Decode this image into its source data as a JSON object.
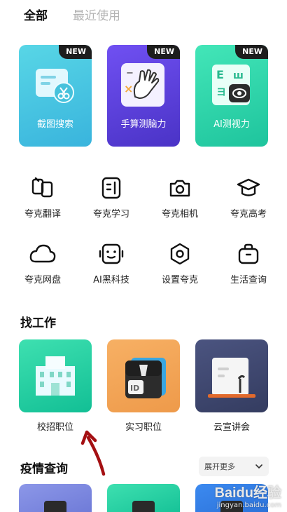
{
  "tabs": [
    {
      "label": "全部",
      "active": true
    },
    {
      "label": "最近使用",
      "active": false
    }
  ],
  "featured": [
    {
      "label": "截图搜索",
      "badge": "NEW",
      "icon": "screenshot-search-icon",
      "colors": [
        "#4fd0e4",
        "#3fb6de"
      ]
    },
    {
      "label": "手算测脑力",
      "badge": "NEW",
      "icon": "hand-calculation-icon",
      "colors": [
        "#6b4cf0",
        "#4a34c9"
      ]
    },
    {
      "label": "AI测视力",
      "badge": "NEW",
      "icon": "eye-chart-icon",
      "colors": [
        "#3ee4b3",
        "#1fc9a0"
      ]
    }
  ],
  "tools_row1": [
    {
      "label": "夸克翻译",
      "icon": "translate-icon"
    },
    {
      "label": "夸克学习",
      "icon": "study-icon"
    },
    {
      "label": "夸克相机",
      "icon": "camera-icon"
    },
    {
      "label": "夸克高考",
      "icon": "graduation-cap-icon"
    }
  ],
  "tools_row2": [
    {
      "label": "夸克网盘",
      "icon": "cloud-icon"
    },
    {
      "label": "AI黑科技",
      "icon": "robot-icon"
    },
    {
      "label": "设置夸克",
      "icon": "settings-hexagon-icon"
    },
    {
      "label": "生活查询",
      "icon": "bag-icon"
    }
  ],
  "jobs_section": {
    "title": "找工作",
    "items": [
      {
        "label": "校招职位",
        "icon": "campus-building-icon"
      },
      {
        "label": "实习职位",
        "icon": "id-card-icon"
      },
      {
        "label": "云宣讲会",
        "icon": "lecture-podium-icon"
      }
    ]
  },
  "epidemic_section": {
    "title": "疫情查询",
    "expand_label": "展开更多"
  },
  "watermark": {
    "main": "Baidu经验",
    "sub": "jingyan.baidu.com"
  }
}
